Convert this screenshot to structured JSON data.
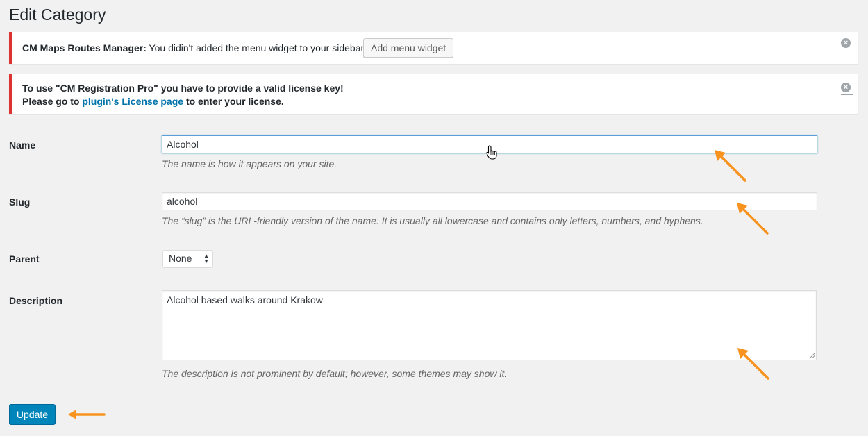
{
  "page": {
    "title": "Edit Category"
  },
  "notices": {
    "maps_routes": {
      "plugin": "CM Maps Routes Manager:",
      "message": " You didin't added the menu widget to your sidebar.",
      "button_label": "Add menu widget"
    },
    "registration": {
      "line1": "To use \"CM Registration Pro\" you have to provide a valid license key!",
      "line2_prefix": "Please go to ",
      "link_text": "plugin's License page",
      "line2_suffix": " to enter your license."
    }
  },
  "form": {
    "name": {
      "label": "Name",
      "value": "Alcohol",
      "description": "The name is how it appears on your site."
    },
    "slug": {
      "label": "Slug",
      "value": "alcohol",
      "description": "The “slug” is the URL-friendly version of the name. It is usually all lowercase and contains only letters, numbers, and hyphens."
    },
    "parent": {
      "label": "Parent",
      "selected": "None"
    },
    "description": {
      "label": "Description",
      "value": "Alcohol based walks around Krakow",
      "description": "The description is not prominent by default; however, some themes may show it."
    },
    "submit_label": "Update"
  },
  "annotations": {
    "arrow_color": "#f7931e"
  },
  "colors": {
    "error_border": "#dc3232",
    "primary_button": "#0085ba",
    "link": "#0073aa"
  }
}
